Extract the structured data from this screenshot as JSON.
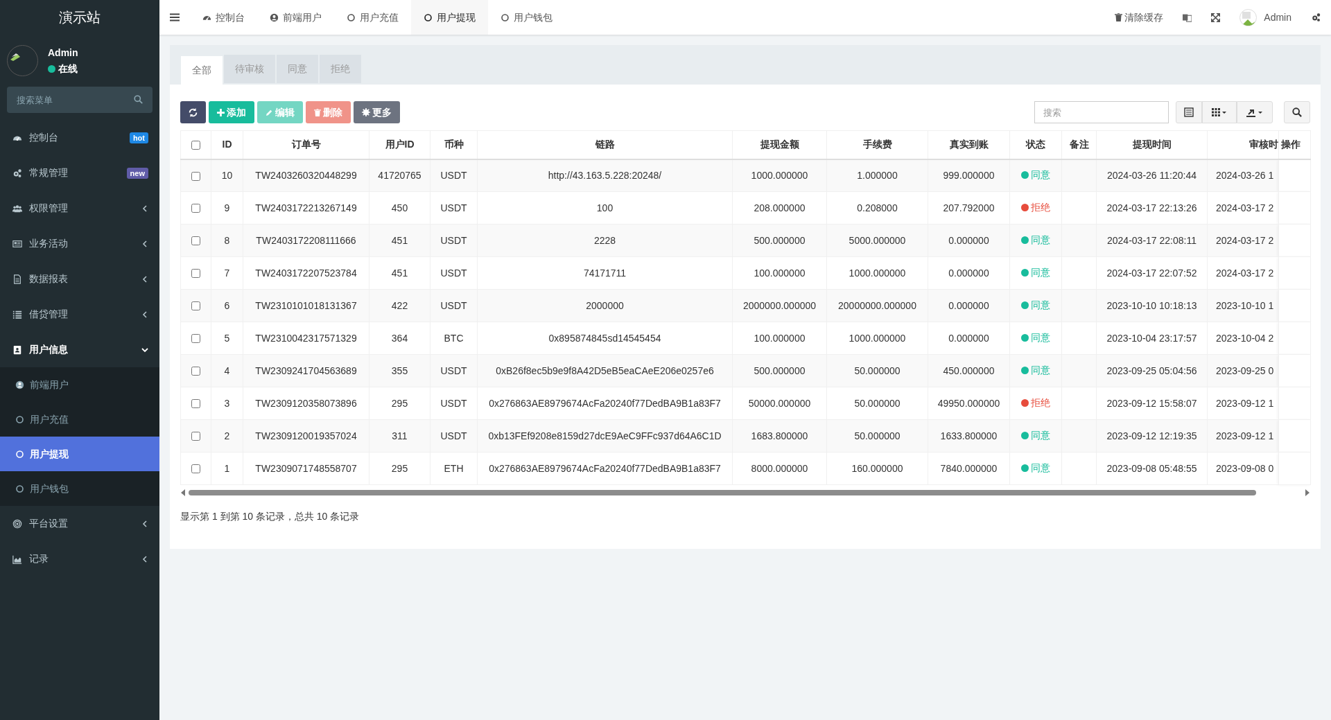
{
  "sidebar": {
    "brand": "演示站",
    "user": {
      "name": "Admin",
      "status": "在线"
    },
    "search": {
      "placeholder": "搜索菜单"
    },
    "items": [
      {
        "label": "控制台",
        "badge": {
          "text": "hot",
          "color": "#1e88e5"
        },
        "expanded": false
      },
      {
        "label": "常规管理",
        "badge": {
          "text": "new",
          "color": "#605ca8"
        },
        "expanded": false
      },
      {
        "label": "权限管理",
        "expanded": false
      },
      {
        "label": "业务活动",
        "expanded": false
      },
      {
        "label": "数据报表",
        "expanded": false
      },
      {
        "label": "借贷管理",
        "expanded": false
      },
      {
        "label": "用户信息",
        "expanded": true,
        "children": [
          {
            "label": "前端用户",
            "selected": false
          },
          {
            "label": "用户充值",
            "selected": false
          },
          {
            "label": "用户提现",
            "selected": true
          },
          {
            "label": "用户钱包",
            "selected": false
          }
        ]
      },
      {
        "label": "平台设置",
        "expanded": false
      },
      {
        "label": "记录",
        "expanded": false
      }
    ]
  },
  "topbar": {
    "tabs": [
      {
        "label": "控制台",
        "selected": false
      },
      {
        "label": "前端用户",
        "selected": false
      },
      {
        "label": "用户充值",
        "selected": false
      },
      {
        "label": "用户提现",
        "selected": true
      },
      {
        "label": "用户钱包",
        "selected": false
      }
    ],
    "clear_cache": "清除缓存",
    "user": "Admin"
  },
  "filter_tabs": [
    {
      "label": "全部",
      "selected": true
    },
    {
      "label": "待审核",
      "selected": false
    },
    {
      "label": "同意",
      "selected": false
    },
    {
      "label": "拒绝",
      "selected": false
    }
  ],
  "toolbar": {
    "buttons": [
      {
        "kind": "refresh"
      },
      {
        "kind": "add",
        "label": "添加"
      },
      {
        "kind": "edit",
        "label": "编辑",
        "disabled": true
      },
      {
        "kind": "delete",
        "label": "删除",
        "disabled": true
      },
      {
        "kind": "more",
        "label": "更多"
      }
    ],
    "search": {
      "placeholder": "搜索"
    }
  },
  "table": {
    "select_all_checked": false,
    "columns": [
      "ID",
      "订单号",
      "用户ID",
      "币种",
      "链路",
      "提现金额",
      "手续费",
      "真实到账",
      "状态",
      "备注",
      "提现时间",
      "审核时",
      "操作"
    ],
    "rows": [
      {
        "checked": false,
        "id": "10",
        "order": "TW2403260320448299",
        "user_id": "41720765",
        "coin": "USDT",
        "link": "http://43.163.5.228:20248/",
        "amount": "1000.000000",
        "fee": "1.000000",
        "received": "999.000000",
        "status": {
          "text": "同意",
          "color": "#18bc9c"
        },
        "time": "2024-03-26 11:20:44",
        "review": "2024-03-26 1"
      },
      {
        "checked": false,
        "id": "9",
        "order": "TW2403172213267149",
        "user_id": "450",
        "coin": "USDT",
        "link": "100",
        "amount": "208.000000",
        "fee": "0.208000",
        "received": "207.792000",
        "status": {
          "text": "拒绝",
          "color": "#e74c3c"
        },
        "time": "2024-03-17 22:13:26",
        "review": "2024-03-17 2"
      },
      {
        "checked": false,
        "id": "8",
        "order": "TW2403172208111666",
        "user_id": "451",
        "coin": "USDT",
        "link": "2228",
        "amount": "500.000000",
        "fee": "5000.000000",
        "received": "0.000000",
        "status": {
          "text": "同意",
          "color": "#18bc9c"
        },
        "time": "2024-03-17 22:08:11",
        "review": "2024-03-17 2"
      },
      {
        "checked": false,
        "id": "7",
        "order": "TW2403172207523784",
        "user_id": "451",
        "coin": "USDT",
        "link": "74171711",
        "amount": "100.000000",
        "fee": "1000.000000",
        "received": "0.000000",
        "status": {
          "text": "同意",
          "color": "#18bc9c"
        },
        "time": "2024-03-17 22:07:52",
        "review": "2024-03-17 2"
      },
      {
        "checked": false,
        "id": "6",
        "order": "TW2310101018131367",
        "user_id": "422",
        "coin": "USDT",
        "link": "2000000",
        "amount": "2000000.000000",
        "fee": "20000000.000000",
        "received": "0.000000",
        "status": {
          "text": "同意",
          "color": "#18bc9c"
        },
        "time": "2023-10-10 10:18:13",
        "review": "2023-10-10 1"
      },
      {
        "checked": false,
        "id": "5",
        "order": "TW2310042317571329",
        "user_id": "364",
        "coin": "BTC",
        "link": "0x895874845sd14545454",
        "amount": "100.000000",
        "fee": "1000.000000",
        "received": "0.000000",
        "status": {
          "text": "同意",
          "color": "#18bc9c"
        },
        "time": "2023-10-04 23:17:57",
        "review": "2023-10-04 2"
      },
      {
        "checked": false,
        "id": "4",
        "order": "TW2309241704563689",
        "user_id": "355",
        "coin": "USDT",
        "link": "0xB26f8ec5b9e9f8A42D5eB5eaCAeE206e0257e6",
        "amount": "500.000000",
        "fee": "50.000000",
        "received": "450.000000",
        "status": {
          "text": "同意",
          "color": "#18bc9c"
        },
        "time": "2023-09-25 05:04:56",
        "review": "2023-09-25 0"
      },
      {
        "checked": false,
        "id": "3",
        "order": "TW2309120358073896",
        "user_id": "295",
        "coin": "USDT",
        "link": "0x276863AE8979674AcFa20240f77DedBA9B1a83F7",
        "amount": "50000.000000",
        "fee": "50.000000",
        "received": "49950.000000",
        "status": {
          "text": "拒绝",
          "color": "#e74c3c"
        },
        "time": "2023-09-12 15:58:07",
        "review": "2023-09-12 1"
      },
      {
        "checked": false,
        "id": "2",
        "order": "TW2309120019357024",
        "user_id": "311",
        "coin": "USDT",
        "link": "0xb13FEf9208e8159d27dcE9AeC9FFc937d64A6C1D",
        "amount": "1683.800000",
        "fee": "50.000000",
        "received": "1633.800000",
        "status": {
          "text": "同意",
          "color": "#18bc9c"
        },
        "time": "2023-09-12 12:19:35",
        "review": "2023-09-12 1"
      },
      {
        "checked": false,
        "id": "1",
        "order": "TW2309071748558707",
        "user_id": "295",
        "coin": "ETH",
        "link": "0x276863AE8979674AcFa20240f77DedBA9B1a83F7",
        "amount": "8000.000000",
        "fee": "160.000000",
        "received": "7840.000000",
        "status": {
          "text": "同意",
          "color": "#18bc9c"
        },
        "time": "2023-09-08 05:48:55",
        "review": "2023-09-08 0"
      }
    ]
  },
  "footer": "显示第 1 到第 10 条记录，总共 10 条记录"
}
